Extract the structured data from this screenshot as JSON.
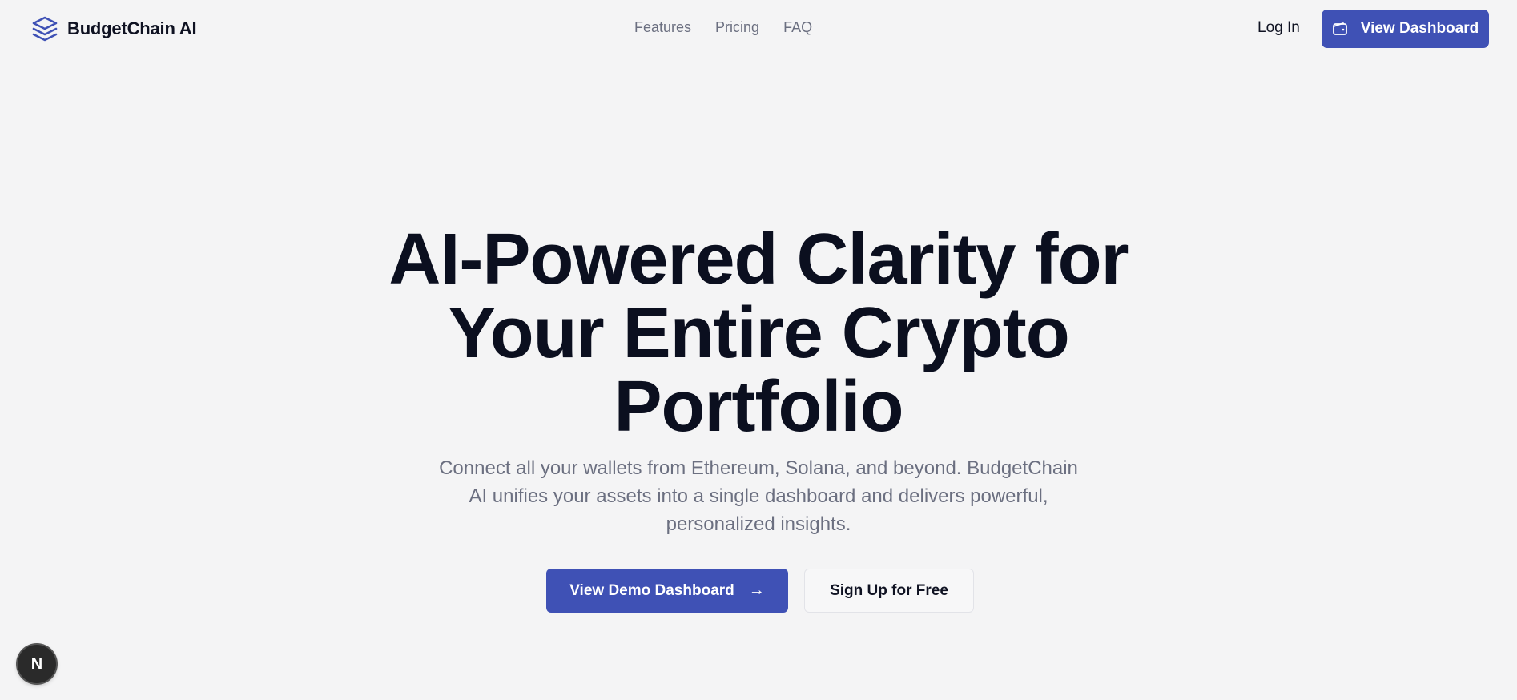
{
  "header": {
    "brand": {
      "name": "BudgetChain AI",
      "icon": "layers-icon"
    },
    "nav": [
      {
        "label": "Features"
      },
      {
        "label": "Pricing"
      },
      {
        "label": "FAQ"
      }
    ],
    "login_label": "Log In",
    "dashboard_button": {
      "label": "View Dashboard",
      "icon": "wallet-icon"
    }
  },
  "hero": {
    "title_lines": [
      "AI-Powered Clarity for",
      "Your Entire Crypto",
      "Portfolio"
    ],
    "subtitle_lines": [
      "Connect all your wallets from Ethereum, Solana, and beyond. BudgetChain",
      "AI unifies your assets into a single dashboard and delivers powerful,",
      "personalized insights."
    ],
    "primary_cta": {
      "label": "View Demo Dashboard",
      "icon": "arrow-right-icon",
      "glyph": "→"
    },
    "secondary_cta": {
      "label": "Sign Up for Free"
    }
  },
  "dev_badge": {
    "label": "N",
    "icon": "nextjs-icon"
  },
  "colors": {
    "accent": "#3f51b5",
    "background": "#f4f4f5",
    "heading": "#0b0f1f",
    "muted_text": "#6b6f80"
  }
}
